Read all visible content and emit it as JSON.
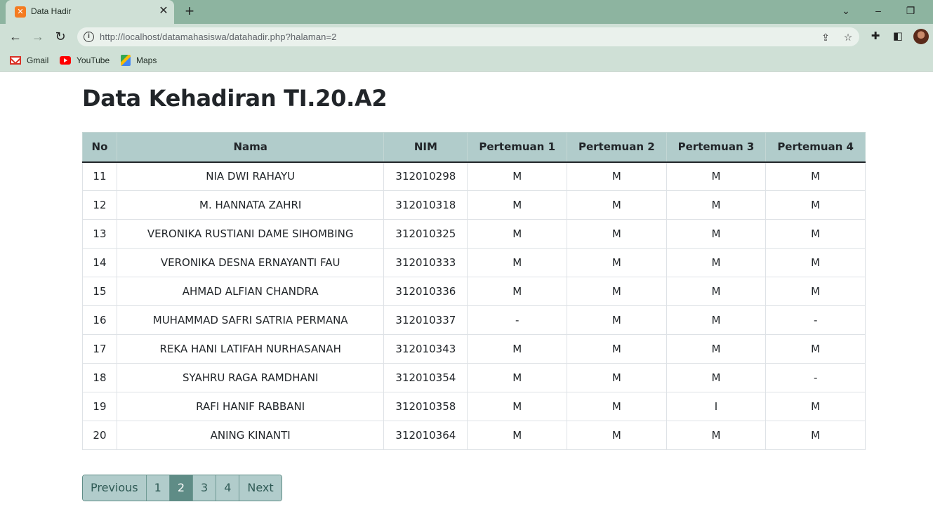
{
  "browser": {
    "tab_title": "Data Hadir",
    "tab_favicon": "xampp-icon",
    "url_host": "http://localhost",
    "url_path": "/datamahasiswa/datahadir.php?halaman=2",
    "bookmarks": [
      {
        "label": "Gmail",
        "icon": "gmail-icon"
      },
      {
        "label": "YouTube",
        "icon": "youtube-icon"
      },
      {
        "label": "Maps",
        "icon": "maps-icon"
      }
    ]
  },
  "page": {
    "title": "Data Kehadiran TI.20.A2"
  },
  "table": {
    "headers": [
      "No",
      "Nama",
      "NIM",
      "Pertemuan 1",
      "Pertemuan 2",
      "Pertemuan 3",
      "Pertemuan 4"
    ],
    "rows": [
      [
        "11",
        "NIA DWI RAHAYU",
        "312010298",
        "M",
        "M",
        "M",
        "M"
      ],
      [
        "12",
        "M. HANNATA ZAHRI",
        "312010318",
        "M",
        "M",
        "M",
        "M"
      ],
      [
        "13",
        "VERONIKA RUSTIANI DAME SIHOMBING",
        "312010325",
        "M",
        "M",
        "M",
        "M"
      ],
      [
        "14",
        "VERONIKA DESNA ERNAYANTI FAU",
        "312010333",
        "M",
        "M",
        "M",
        "M"
      ],
      [
        "15",
        "AHMAD ALFIAN CHANDRA",
        "312010336",
        "M",
        "M",
        "M",
        "M"
      ],
      [
        "16",
        "MUHAMMAD SAFRI SATRIA PERMANA",
        "312010337",
        "-",
        "M",
        "M",
        "-"
      ],
      [
        "17",
        "REKA HANI LATIFAH NURHASANAH",
        "312010343",
        "M",
        "M",
        "M",
        "M"
      ],
      [
        "18",
        "SYAHRU RAGA RAMDHANI",
        "312010354",
        "M",
        "M",
        "M",
        "-"
      ],
      [
        "19",
        "RAFI HANIF RABBANI",
        "312010358",
        "M",
        "M",
        "I",
        "M"
      ],
      [
        "20",
        "ANING KINANTI",
        "312010364",
        "M",
        "M",
        "M",
        "M"
      ]
    ]
  },
  "pagination": {
    "previous": "Previous",
    "pages": [
      "1",
      "2",
      "3",
      "4"
    ],
    "active": "2",
    "next": "Next"
  },
  "colors": {
    "chrome_frame": "#8db4a0",
    "chrome_toolbar": "#cfe0d6",
    "table_header": "#b1cccb",
    "pagination_active": "#5f8c86"
  }
}
